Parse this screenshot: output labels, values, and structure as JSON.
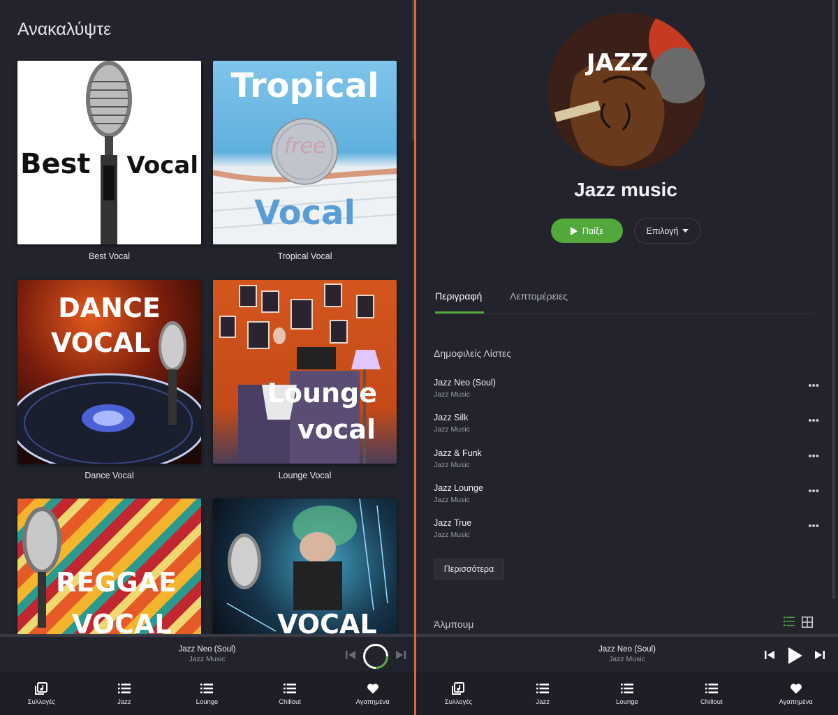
{
  "left": {
    "title": "Ανακαλύψτε",
    "tiles": [
      {
        "caption": "Best Vocal",
        "art_lines": [
          "Best",
          "Vocal"
        ]
      },
      {
        "caption": "Tropical Vocal",
        "art_lines": [
          "Tropical",
          "Vocal"
        ],
        "art_stamp": "free"
      },
      {
        "caption": "Dance Vocal",
        "art_lines": [
          "DANCE",
          "VOCAL"
        ]
      },
      {
        "caption": "Lounge Vocal",
        "art_lines": [
          "Lounge",
          "vocal"
        ]
      },
      {
        "caption": "",
        "art_lines": [
          "REGGAE",
          "VOCAL"
        ]
      },
      {
        "caption": "",
        "art_lines": [
          "VOCAL"
        ]
      }
    ]
  },
  "player": {
    "track_title": "Jazz Neo (Soul)",
    "track_artist": "Jazz Music"
  },
  "nav": [
    {
      "label": "Συλλογές",
      "icon": "collections-icon"
    },
    {
      "label": "Jazz",
      "icon": "list-icon"
    },
    {
      "label": "Lounge",
      "icon": "list-icon"
    },
    {
      "label": "Chillout",
      "icon": "list-icon"
    },
    {
      "label": "Αγαπημένα",
      "icon": "heart-icon"
    }
  ],
  "right": {
    "cover_text": "JAZZ",
    "playlist_title": "Jazz music",
    "play_label": "Παίξε",
    "option_label": "Επιλογή",
    "tabs": [
      {
        "label": "Περιγραφή",
        "active": true
      },
      {
        "label": "Λεπτομέρειες",
        "active": false
      }
    ],
    "popular_title": "Δημοφιλείς Λίστες",
    "popular": [
      {
        "title": "Jazz Neo (Soul)",
        "subtitle": "Jazz Music"
      },
      {
        "title": "Jazz Silk",
        "subtitle": "Jazz Music"
      },
      {
        "title": "Jazz & Funk",
        "subtitle": "Jazz Music"
      },
      {
        "title": "Jazz Lounge",
        "subtitle": "Jazz Music"
      },
      {
        "title": "Jazz True",
        "subtitle": "Jazz Music"
      }
    ],
    "more_label": "Περισσότερα",
    "albums_title": "Άλμπουμ"
  },
  "colors": {
    "accent_green": "#53a83b",
    "divider_orange": "#e2643d",
    "background": "#22232c"
  }
}
